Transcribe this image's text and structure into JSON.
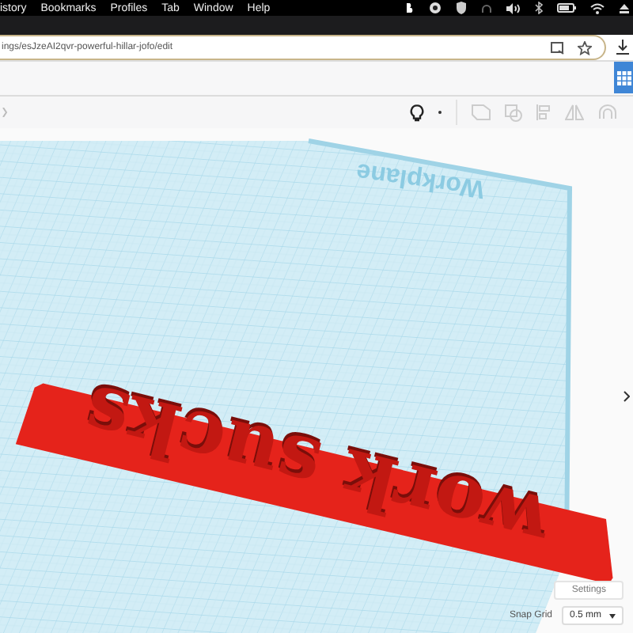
{
  "menu_bar": {
    "items": [
      "istory",
      "Bookmarks",
      "Profiles",
      "Tab",
      "Window",
      "Help"
    ]
  },
  "address_bar": {
    "url": "ings/esJzeAI2qvr-powerful-hillar-jofo/edit"
  },
  "workplane": {
    "label": "Workplane"
  },
  "model": {
    "text": "work sucks"
  },
  "panel": {
    "settings_button": "Settings",
    "snap_grid": {
      "label": "Snap Grid",
      "value": "0.5 mm"
    }
  }
}
